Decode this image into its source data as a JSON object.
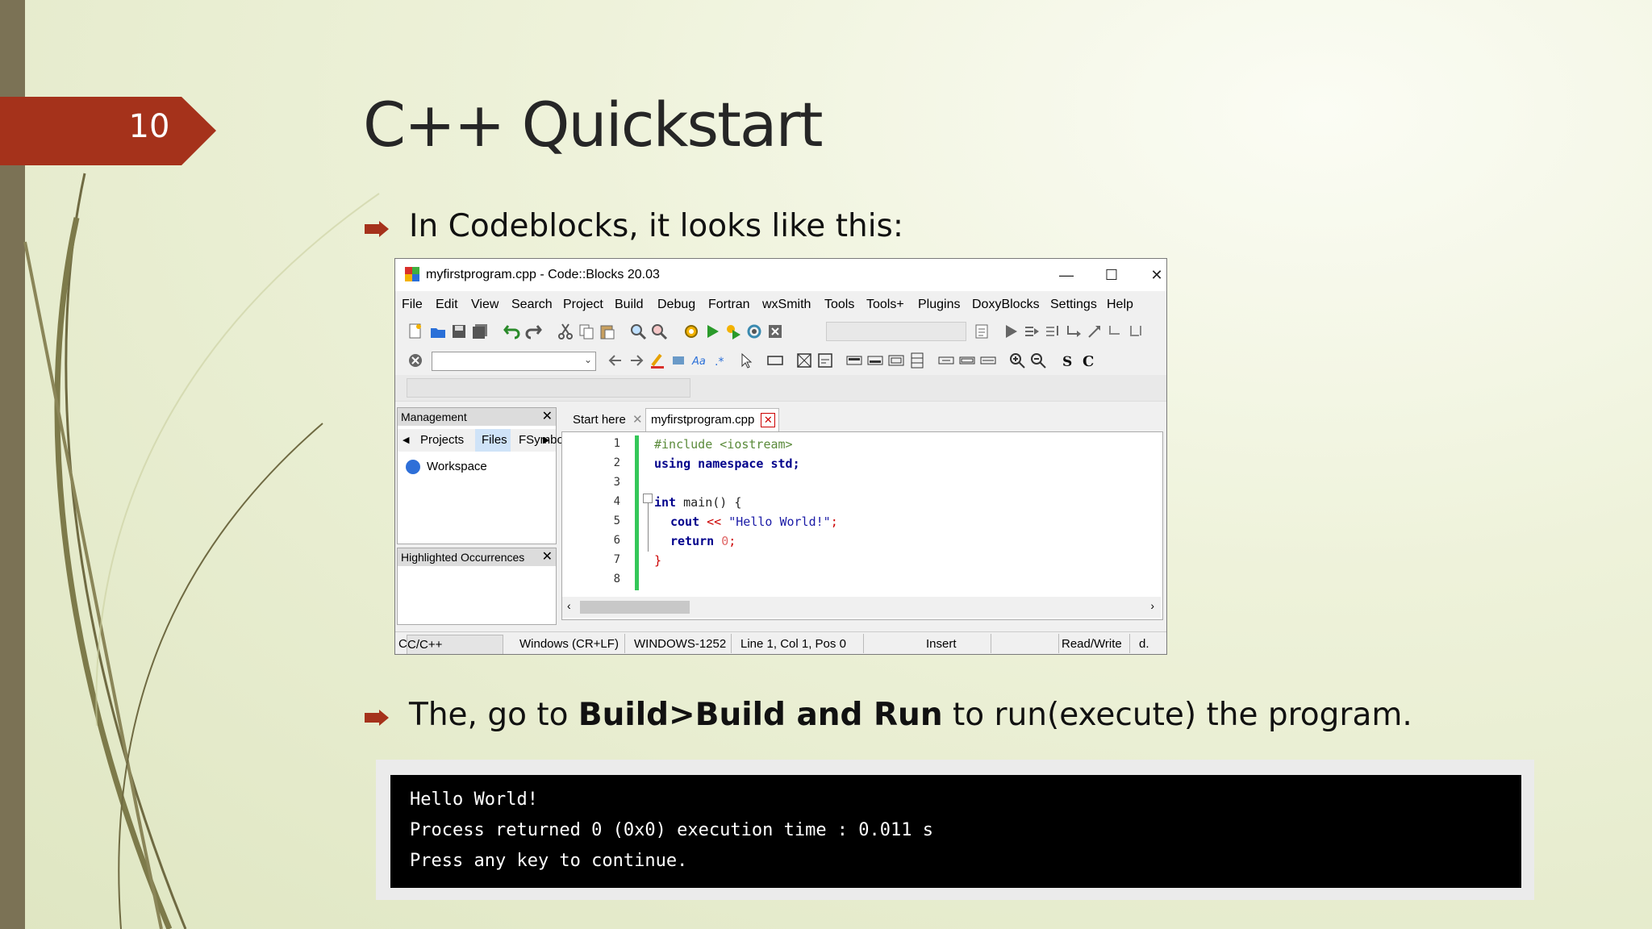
{
  "slide": {
    "number": "10",
    "title": "C++ Quickstart",
    "bullet1": "In Codeblocks, it looks like this:",
    "bullet2": {
      "pre": "The, go to ",
      "bold": "Build>Build and Run",
      "post": " to run(execute) the program."
    }
  },
  "colors": {
    "accent": "#a5321b",
    "left_bar": "#7b7255"
  },
  "codeblocks": {
    "window_title": "myfirstprogram.cpp - Code::Blocks 20.03",
    "window_buttons": [
      "minimize",
      "maximize",
      "close"
    ],
    "menu": [
      "File",
      "Edit",
      "View",
      "Search",
      "Project",
      "Build",
      "Debug",
      "Fortran",
      "wxSmith",
      "Tools",
      "Tools+",
      "Plugins",
      "DoxyBlocks",
      "Settings",
      "Help"
    ],
    "management": {
      "title": "Management",
      "tabs": [
        "Projects",
        "Files",
        "FSymbols"
      ],
      "selected_tab": "Files",
      "tree_root": "Workspace"
    },
    "highlighted_occurrences": {
      "title": "Highlighted Occurrences"
    },
    "editor_tabs": [
      "Start here",
      "myfirstprogram.cpp"
    ],
    "active_editor_tab": "myfirstprogram.cpp",
    "line_numbers": [
      "1",
      "2",
      "3",
      "4",
      "5",
      "6",
      "7",
      "8"
    ],
    "code": {
      "line1": "#include <iostream>",
      "line2_kw": "using namespace",
      "line2_rest": " std;",
      "line4_kw": "int",
      "line4_rest": " main() {",
      "line5_a": "cout",
      "line5_op": " << ",
      "line5_str": "\"Hello World!\"",
      "line5_end": ";",
      "line6_kw": "return",
      "line6_num": " 0",
      "line6_end": ";",
      "line7": "}"
    },
    "status": {
      "lang": "C/C++",
      "lang_prefix": "C",
      "eol": "Windows (CR+LF)",
      "encoding": "WINDOWS-1252",
      "position": "Line 1, Col 1, Pos 0",
      "mode": "Insert",
      "access": "Read/Write",
      "extra": "d."
    }
  },
  "console": {
    "lines": [
      "Hello World!",
      "Process returned 0 (0x0) execution time : 0.011 s",
      "Press any key to continue."
    ]
  }
}
